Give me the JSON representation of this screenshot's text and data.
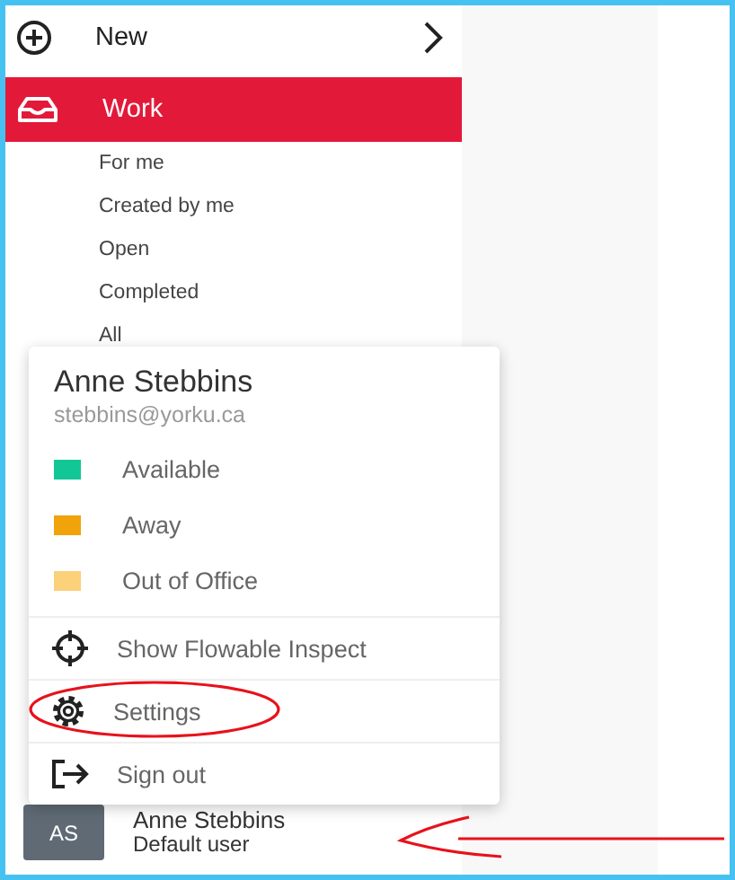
{
  "sidebar": {
    "items": [
      {
        "label": "New",
        "kind": "action",
        "selected": false
      },
      {
        "label": "Work",
        "kind": "section",
        "selected": true,
        "children": [
          {
            "label": "For me"
          },
          {
            "label": "Created by me"
          },
          {
            "label": "Open"
          },
          {
            "label": "Completed"
          },
          {
            "label": "All"
          }
        ]
      }
    ]
  },
  "user_menu": {
    "name": "Anne Stebbins",
    "email": "stebbins@yorku.ca",
    "statuses": [
      {
        "label": "Available",
        "color": "#12c795"
      },
      {
        "label": "Away",
        "color": "#f0a30a"
      },
      {
        "label": "Out of Office",
        "color": "#fbd17a"
      }
    ],
    "actions": [
      {
        "label": "Show Flowable Inspect",
        "kind": "inspect"
      },
      {
        "label": "Settings",
        "kind": "settings"
      },
      {
        "label": "Sign out",
        "kind": "signout"
      }
    ]
  },
  "user_footer": {
    "initials": "AS",
    "name": "Anne Stebbins",
    "role": "Default user"
  },
  "annotations": [
    {
      "kind": "circle"
    },
    {
      "kind": "arrow"
    }
  ]
}
